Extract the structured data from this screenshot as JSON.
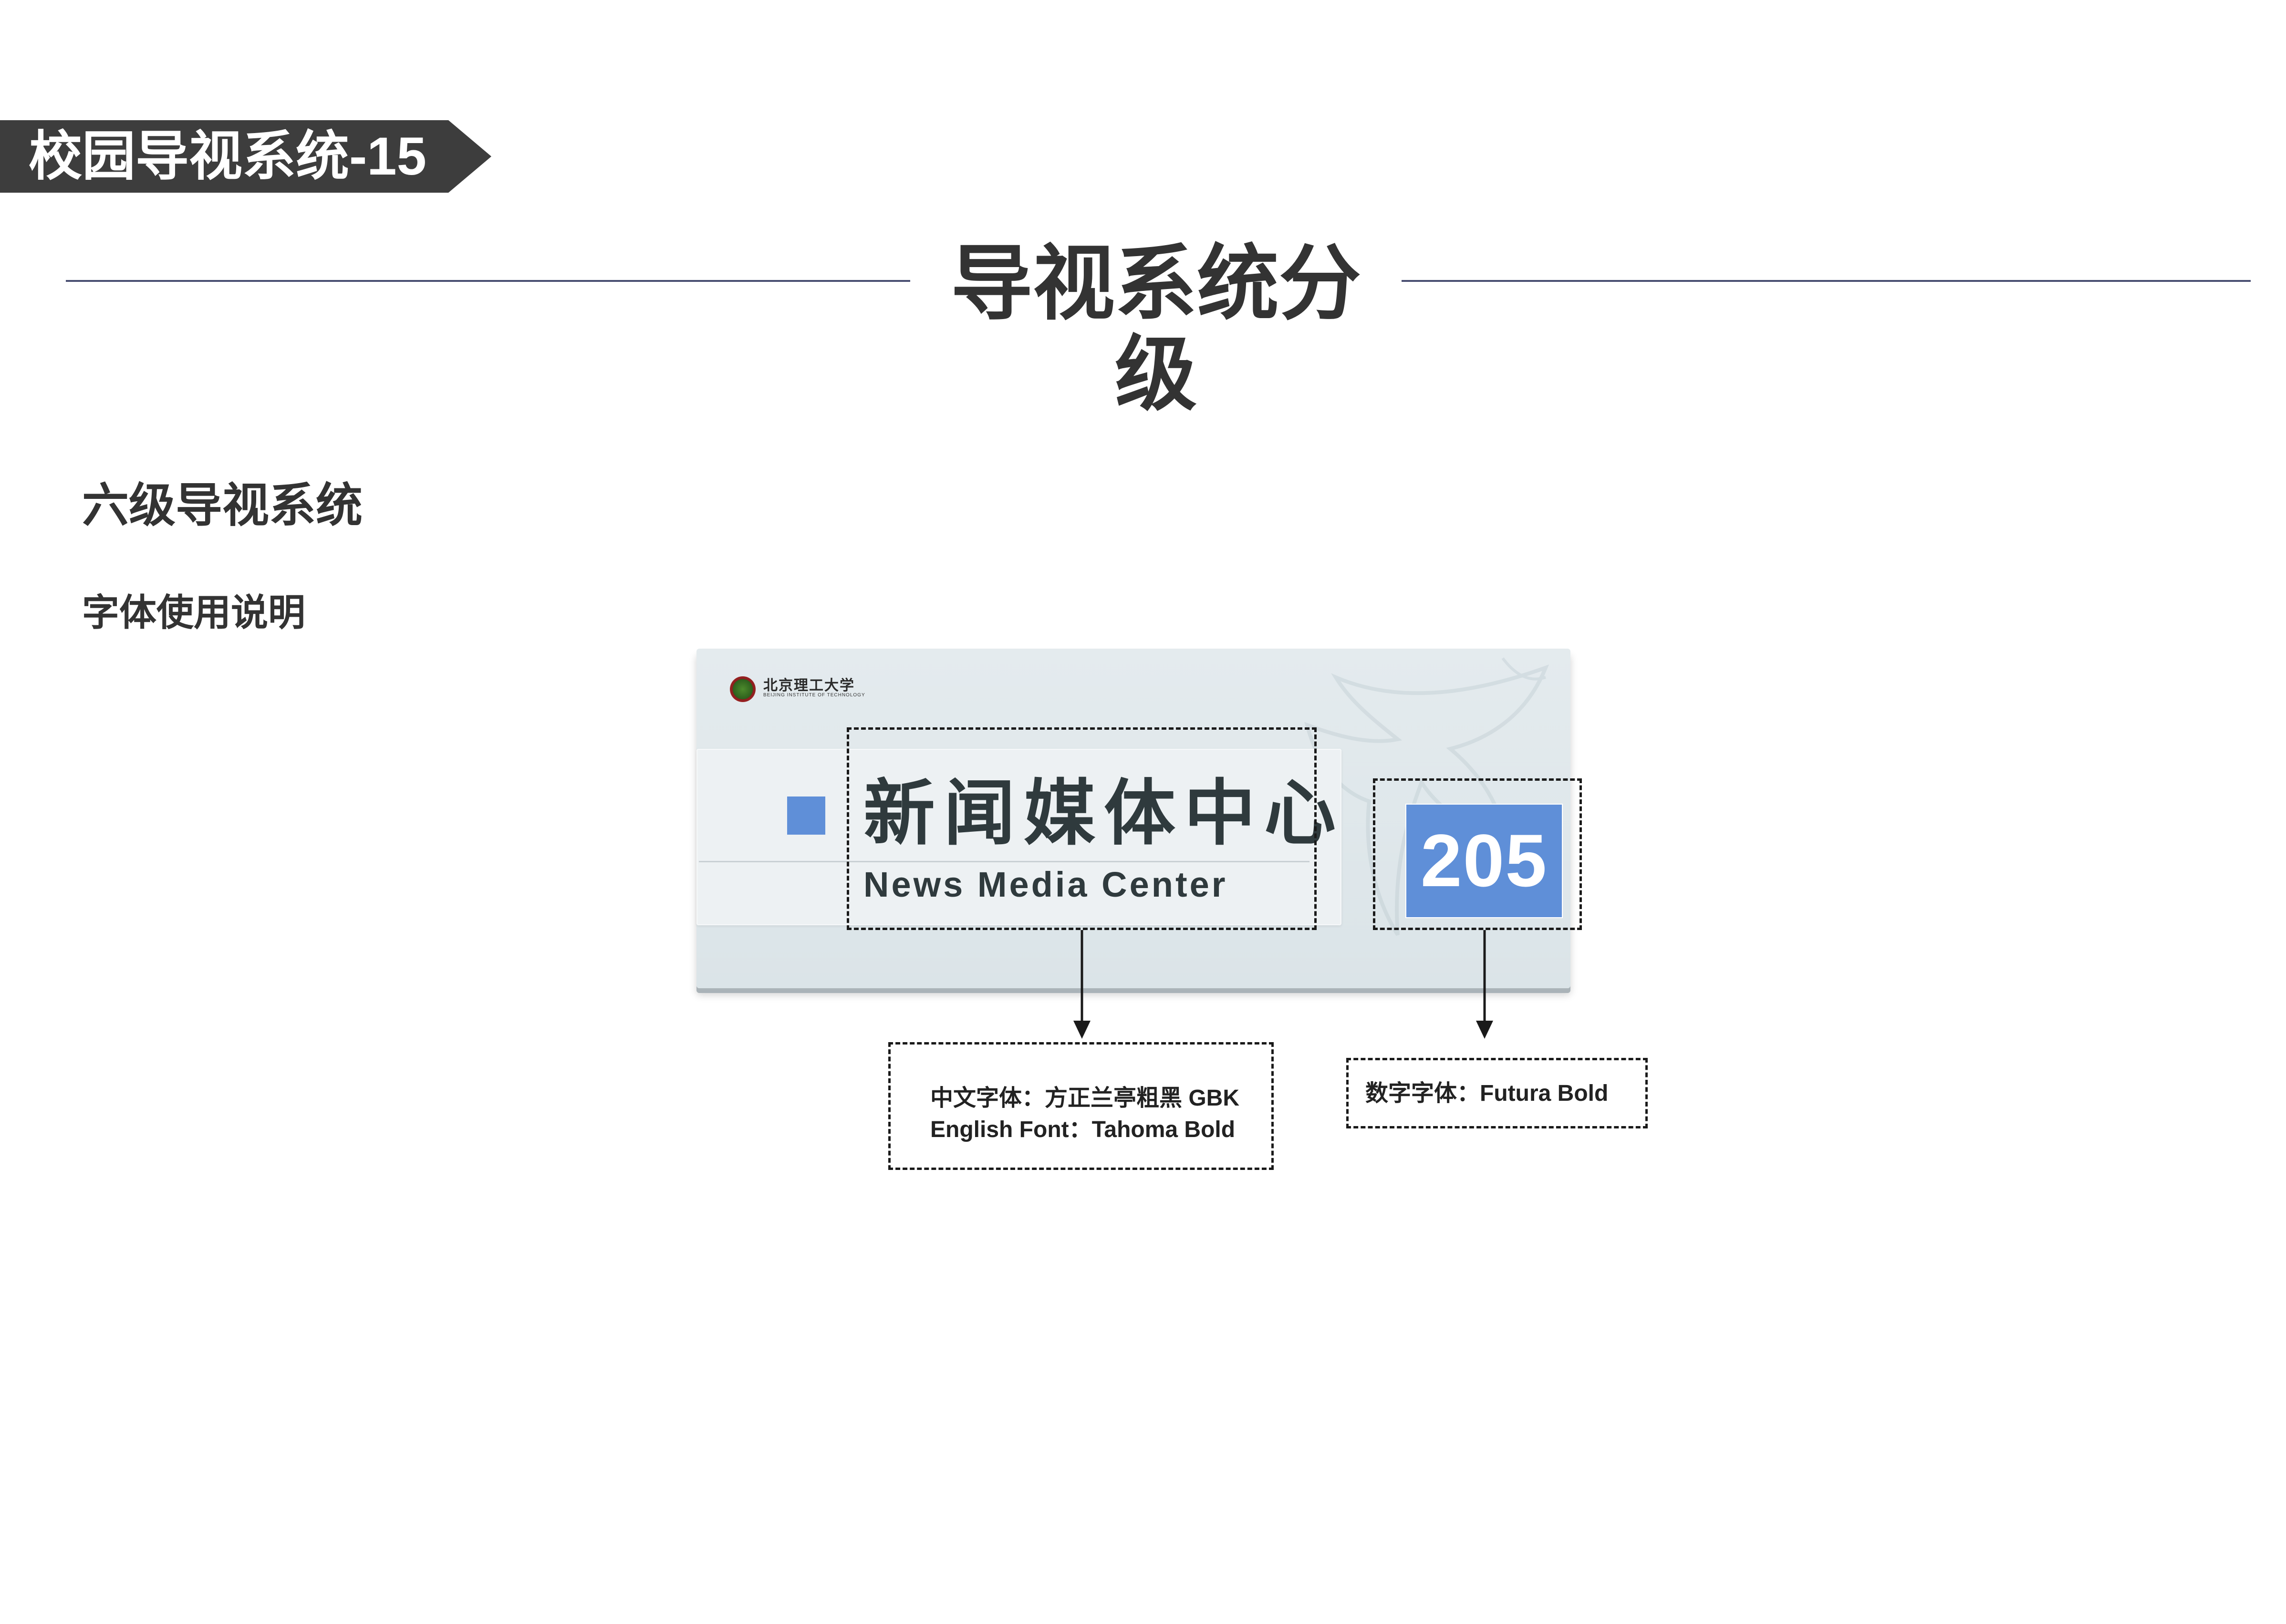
{
  "header": {
    "tab_label": "校园导视系统-15",
    "main_title": "导视系统分级"
  },
  "section": {
    "title": "六级导视系统",
    "subtitle": "字体使用说明"
  },
  "sign": {
    "logo_cn": "北京理工大学",
    "logo_en": "BEIJING INSTITUTE OF TECHNOLOGY",
    "name_cn": "新闻媒体中心",
    "name_en": "News Media Center",
    "room_number": "205",
    "accent_color": "#5f8fd8"
  },
  "notes": {
    "chinese_font": "中文字体：方正兰亭粗黑 GBK",
    "english_font": "English Font：Tahoma Bold",
    "number_font": "数字字体：Futura Bold"
  }
}
